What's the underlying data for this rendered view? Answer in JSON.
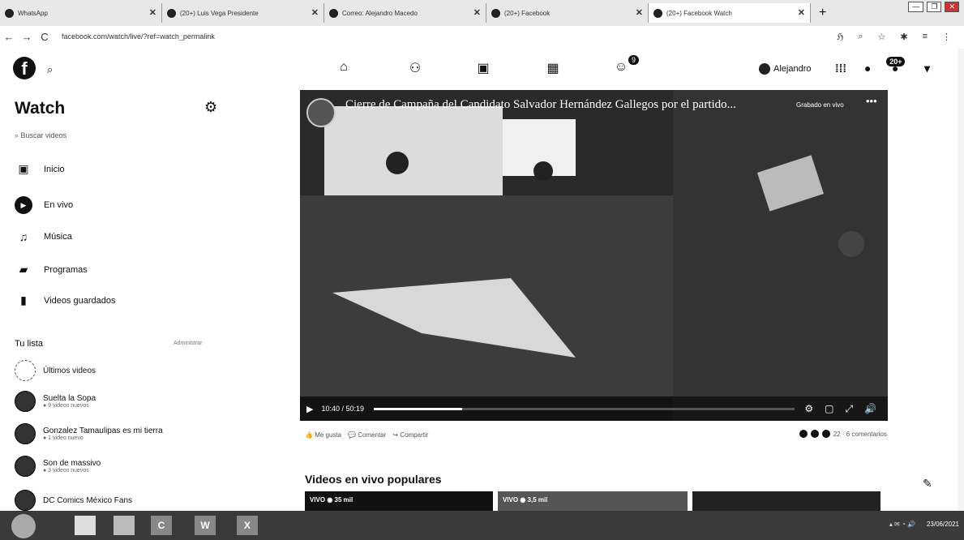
{
  "browser": {
    "tabs": [
      {
        "title": "WhatsApp",
        "active": false
      },
      {
        "title": "(20+) Luis Vega Presidente",
        "active": false
      },
      {
        "title": "Correo: Alejandro Macedo",
        "active": false
      },
      {
        "title": "(20+) Facebook",
        "active": false
      },
      {
        "title": "(20+) Facebook Watch",
        "active": true
      }
    ],
    "new_tab": "+",
    "url": "facebook.com/watch/live/?ref=watch_permalink",
    "nav": {
      "back": "←",
      "forward": "→",
      "reload": "C"
    }
  },
  "fbnav": {
    "logo": "f",
    "profile_name": "Alejandro",
    "notif_badge": "20+",
    "gaming_badge": "9"
  },
  "sidebar": {
    "title": "Watch",
    "search_placeholder": "Buscar videos",
    "items": [
      {
        "label": "Inicio",
        "icon": "tv-icon"
      },
      {
        "label": "En vivo",
        "icon": "live-icon"
      },
      {
        "label": "Música",
        "icon": "music-icon"
      },
      {
        "label": "Programas",
        "icon": "shows-icon"
      },
      {
        "label": "Videos guardados",
        "icon": "bookmark-icon"
      }
    ],
    "list_title": "Tu lista",
    "list_action": "Administrar",
    "list": [
      {
        "name": "Últimos videos",
        "sub": ""
      },
      {
        "name": "Suelta la Sopa",
        "sub": "● 9 videos nuevos"
      },
      {
        "name": "Gonzalez Tamaulipas es mi tierra",
        "sub": "● 1 video nuevo"
      },
      {
        "name": "Son de massivo",
        "sub": "● 3 videos nuevos"
      },
      {
        "name": "DC Comics México Fans",
        "sub": ""
      }
    ]
  },
  "video": {
    "title": "Cierre de Campaña del Candidato Salvador Hernández Gallegos por el partido...",
    "live_label": "Grabado en vivo",
    "time": "10:40 / 50:19",
    "progress": 0.21
  },
  "reactions": {
    "like": "Me gusta",
    "comment": "Comentar",
    "share": "Compartir",
    "count": "22 · 6 comentarios"
  },
  "popular": {
    "title": "Videos en vivo populares",
    "thumbs": [
      {
        "label": "VIVO  ◉ 35 mil"
      },
      {
        "label": "VIVO  ◉ 3,5 mil"
      },
      {
        "label": ""
      },
      {
        "label": ""
      }
    ]
  },
  "taskbar": {
    "apps": [
      "C",
      "W",
      "X"
    ],
    "date": "23/06/2021"
  }
}
